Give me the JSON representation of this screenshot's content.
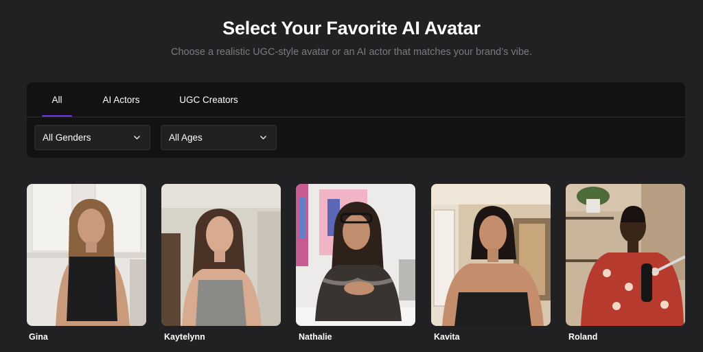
{
  "header": {
    "title": "Select Your Favorite AI Avatar",
    "subtitle": "Choose a realistic UGC-style avatar or an AI actor that matches your brand’s vibe."
  },
  "tabs": [
    {
      "label": "All",
      "active": true
    },
    {
      "label": "AI Actors",
      "active": false
    },
    {
      "label": "UGC Creators",
      "active": false
    }
  ],
  "filters": {
    "gender": {
      "selected": "All Genders",
      "icon": "chevron-down-icon"
    },
    "age": {
      "selected": "All Ages",
      "icon": "chevron-down-icon"
    }
  },
  "avatars": [
    {
      "name": "Gina"
    },
    {
      "name": "Kaytelynn"
    },
    {
      "name": "Nathalie"
    },
    {
      "name": "Kavita"
    },
    {
      "name": "Roland"
    }
  ],
  "colors": {
    "background": "#212123",
    "panel": "#121214",
    "accent": "#6a3df0",
    "subtitle": "#7a7a80"
  }
}
